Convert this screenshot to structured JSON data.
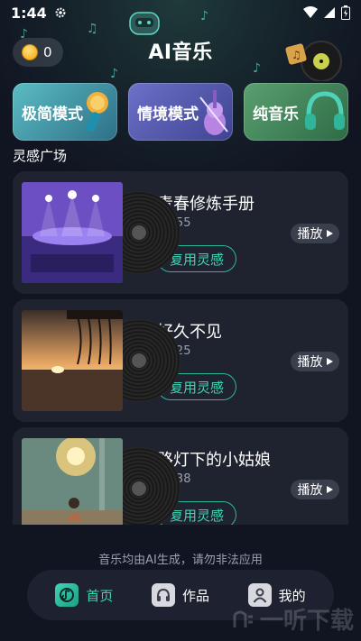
{
  "status_bar": {
    "time": "1:44"
  },
  "header": {
    "title": "AI音乐",
    "coin_count": "0"
  },
  "modes": [
    {
      "label": "极简模式",
      "icon": "microphone-icon"
    },
    {
      "label": "情境模式",
      "icon": "violin-icon"
    },
    {
      "label": "纯音乐",
      "icon": "headphones-icon"
    }
  ],
  "section": {
    "title": "灵感广场"
  },
  "songs": [
    {
      "title": "青春修炼手册",
      "duration": "02:55",
      "reuse_label": "复用灵感",
      "play_label": "播放"
    },
    {
      "title": "好久不见",
      "duration": "03:25",
      "reuse_label": "复用灵感",
      "play_label": "播放"
    },
    {
      "title": "路灯下的小姑娘",
      "duration": "02:38",
      "reuse_label": "复用灵感",
      "play_label": "播放"
    }
  ],
  "disclaimer": "音乐均由AI生成，请勿非法应用",
  "tabs": [
    {
      "label": "首页",
      "active": true
    },
    {
      "label": "作品",
      "active": false
    },
    {
      "label": "我的",
      "active": false
    }
  ],
  "watermark": "一听下载",
  "colors": {
    "accent": "#3cd6b5",
    "background": "#111522",
    "card": "#1f2330"
  }
}
